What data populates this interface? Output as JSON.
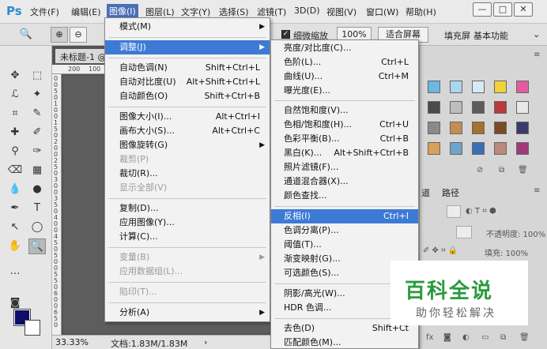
{
  "app": {
    "logo": "Ps",
    "menu": [
      "文件(F)",
      "编辑(E)",
      "图像(I)",
      "图层(L)",
      "文字(Y)",
      "选择(S)",
      "滤镜(T)",
      "3D(D)",
      "视图(V)",
      "窗口(W)",
      "帮助(H)"
    ],
    "active_menu_index": 2,
    "window_buttons": [
      "—",
      "□",
      "✕"
    ]
  },
  "options": {
    "scrubby_zoom_label": "细微缩放",
    "zoom_pct": "100%",
    "fit_screen": "适合屏幕",
    "fill_screen": "填充屏",
    "workspace": "基本功能"
  },
  "document": {
    "tab_title": "未标题-1 @",
    "ruler_h": [
      "200",
      "100"
    ],
    "ruler_v": [
      "0",
      "0",
      "5",
      "0",
      "1",
      "0",
      "0",
      "1",
      "5",
      "0",
      "2",
      "0",
      "0",
      "2",
      "5",
      "0",
      "3",
      "0",
      "0",
      "3",
      "5",
      "0",
      "4",
      "0",
      "0",
      "4",
      "5",
      "0",
      "5",
      "0",
      "0",
      "5",
      "5",
      "0",
      "6",
      "0",
      "0",
      "6",
      "5",
      "0"
    ],
    "zoom_level": "33.33%",
    "doc_info": "文档:1.83M/1.83M"
  },
  "image_menu": {
    "items": [
      {
        "label": "模式(M)",
        "shortcut": "",
        "submenu": true,
        "disabled": false
      },
      {
        "label": "调整(J)",
        "shortcut": "",
        "submenu": true,
        "disabled": false,
        "highlight": true
      },
      {
        "label": "自动色调(N)",
        "shortcut": "Shift+Ctrl+L",
        "disabled": false
      },
      {
        "label": "自动对比度(U)",
        "shortcut": "Alt+Shift+Ctrl+L",
        "disabled": false
      },
      {
        "label": "自动颜色(O)",
        "shortcut": "Shift+Ctrl+B",
        "disabled": false
      },
      {
        "label": "图像大小(I)...",
        "shortcut": "Alt+Ctrl+I",
        "disabled": false
      },
      {
        "label": "画布大小(S)...",
        "shortcut": "Alt+Ctrl+C",
        "disabled": false
      },
      {
        "label": "图像旋转(G)",
        "shortcut": "",
        "submenu": true,
        "disabled": false
      },
      {
        "label": "裁剪(P)",
        "shortcut": "",
        "disabled": true
      },
      {
        "label": "裁切(R)...",
        "shortcut": "",
        "disabled": false
      },
      {
        "label": "显示全部(V)",
        "shortcut": "",
        "disabled": true
      },
      {
        "label": "复制(D)...",
        "shortcut": "",
        "disabled": false
      },
      {
        "label": "应用图像(Y)...",
        "shortcut": "",
        "disabled": false
      },
      {
        "label": "计算(C)...",
        "shortcut": "",
        "disabled": false
      },
      {
        "label": "变量(B)",
        "shortcut": "",
        "submenu": true,
        "disabled": true
      },
      {
        "label": "应用数据组(L)...",
        "shortcut": "",
        "disabled": true
      },
      {
        "label": "陷印(T)...",
        "shortcut": "",
        "disabled": true
      },
      {
        "label": "分析(A)",
        "shortcut": "",
        "submenu": true,
        "disabled": false
      }
    ]
  },
  "adjust_menu": {
    "items": [
      {
        "label": "亮度/对比度(C)...",
        "shortcut": ""
      },
      {
        "label": "色阶(L)...",
        "shortcut": "Ctrl+L"
      },
      {
        "label": "曲线(U)...",
        "shortcut": "Ctrl+M"
      },
      {
        "label": "曝光度(E)...",
        "shortcut": ""
      },
      {
        "label": "自然饱和度(V)...",
        "shortcut": ""
      },
      {
        "label": "色相/饱和度(H)...",
        "shortcut": "Ctrl+U"
      },
      {
        "label": "色彩平衡(B)...",
        "shortcut": "Ctrl+B"
      },
      {
        "label": "黑白(K)...",
        "shortcut": "Alt+Shift+Ctrl+B"
      },
      {
        "label": "照片滤镜(F)...",
        "shortcut": ""
      },
      {
        "label": "通道混合器(X)...",
        "shortcut": ""
      },
      {
        "label": "颜色查找...",
        "shortcut": ""
      },
      {
        "label": "反相(I)",
        "shortcut": "Ctrl+I",
        "highlight": true
      },
      {
        "label": "色调分离(P)...",
        "shortcut": ""
      },
      {
        "label": "阈值(T)...",
        "shortcut": ""
      },
      {
        "label": "渐变映射(G)...",
        "shortcut": ""
      },
      {
        "label": "可选颜色(S)...",
        "shortcut": ""
      },
      {
        "label": "阴影/高光(W)...",
        "shortcut": ""
      },
      {
        "label": "HDR 色调...",
        "shortcut": ""
      },
      {
        "label": "去色(D)",
        "shortcut": "Shift+Ct"
      },
      {
        "label": "匹配颜色(M)...",
        "shortcut": ""
      }
    ]
  },
  "panels": {
    "tab_channels": "道",
    "tab_paths": "路径",
    "opacity_label": "不透明度: 100%",
    "fill_label": "填充: 100%"
  },
  "watermark": {
    "title": "百科全说",
    "subtitle": "助你轻松解决"
  },
  "colors": {
    "foreground": "#0e0e68",
    "background": "#ffffff",
    "highlight": "#3d7ad6"
  }
}
